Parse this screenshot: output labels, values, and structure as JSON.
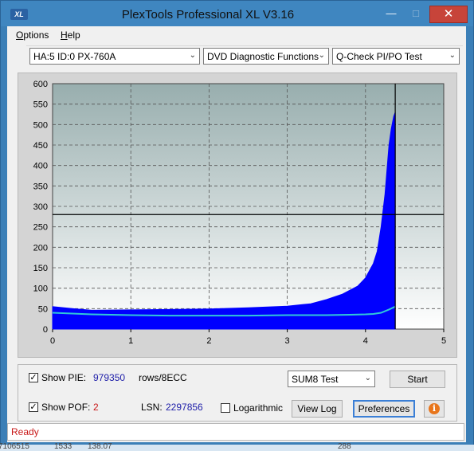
{
  "window": {
    "title": "PlexTools Professional XL V3.16",
    "icon_label": "XL",
    "minimize": "—",
    "maximize": "□",
    "close": "✕"
  },
  "menu": [
    {
      "label": "Options",
      "underline": "O",
      "rest": "ptions"
    },
    {
      "label": "Help",
      "underline": "H",
      "rest": "elp"
    }
  ],
  "toolbar": {
    "drive": "HA:5 ID:0  PX-760A",
    "function": "DVD Diagnostic Functions",
    "test": "Q-Check PI/PO Test"
  },
  "chart_data": {
    "type": "area",
    "title": "",
    "xlabel": "",
    "ylabel": "",
    "xlim": [
      0,
      5
    ],
    "ylim": [
      0,
      600
    ],
    "x_ticks": [
      "0",
      "1",
      "2",
      "3",
      "4",
      "5"
    ],
    "y_ticks": [
      "0",
      "50",
      "100",
      "150",
      "200",
      "250",
      "300",
      "350",
      "400",
      "450",
      "500",
      "550",
      "600"
    ],
    "threshold_line": 280,
    "end_marker_x": 4.38,
    "series": [
      {
        "color": "#0000ff",
        "x": [
          0,
          0.25,
          0.5,
          1.0,
          1.5,
          2.0,
          2.5,
          3.0,
          3.3,
          3.5,
          3.7,
          3.9,
          4.0,
          4.1,
          4.15,
          4.2,
          4.25,
          4.3,
          4.33,
          4.36,
          4.38
        ],
        "values": [
          55,
          50,
          46,
          47,
          48,
          49,
          52,
          56,
          62,
          72,
          85,
          105,
          125,
          160,
          190,
          250,
          330,
          450,
          490,
          520,
          530
        ]
      },
      {
        "color": "#30c8d8",
        "x": [
          0,
          0.5,
          1.0,
          1.5,
          2.0,
          2.5,
          3.0,
          3.5,
          3.8,
          4.0,
          4.1,
          4.2,
          4.3,
          4.38
        ],
        "values": [
          40,
          36,
          34,
          33,
          33,
          33,
          34,
          34,
          35,
          36,
          37,
          40,
          48,
          55
        ]
      }
    ]
  },
  "controls": {
    "show_pie_label": "Show PIE:",
    "pie_value": "979350",
    "pie_unit": "rows/8ECC",
    "show_poe_label": "Show POF:",
    "poe_value": "2",
    "lsn_label": "LSN:",
    "lsn_value": "2297856",
    "logarithmic_label": "Logarithmic",
    "sum_select": "SUM8 Test",
    "start_label": "Start",
    "view_log_label": "View Log",
    "preferences_label": "Preferences",
    "info_label": "i",
    "check_mark": "✓",
    "arrow": "⌄"
  },
  "status": {
    "text": "Ready"
  },
  "background": {
    "fragments": [
      "7106515",
      "1533",
      "138.07",
      "288"
    ]
  }
}
